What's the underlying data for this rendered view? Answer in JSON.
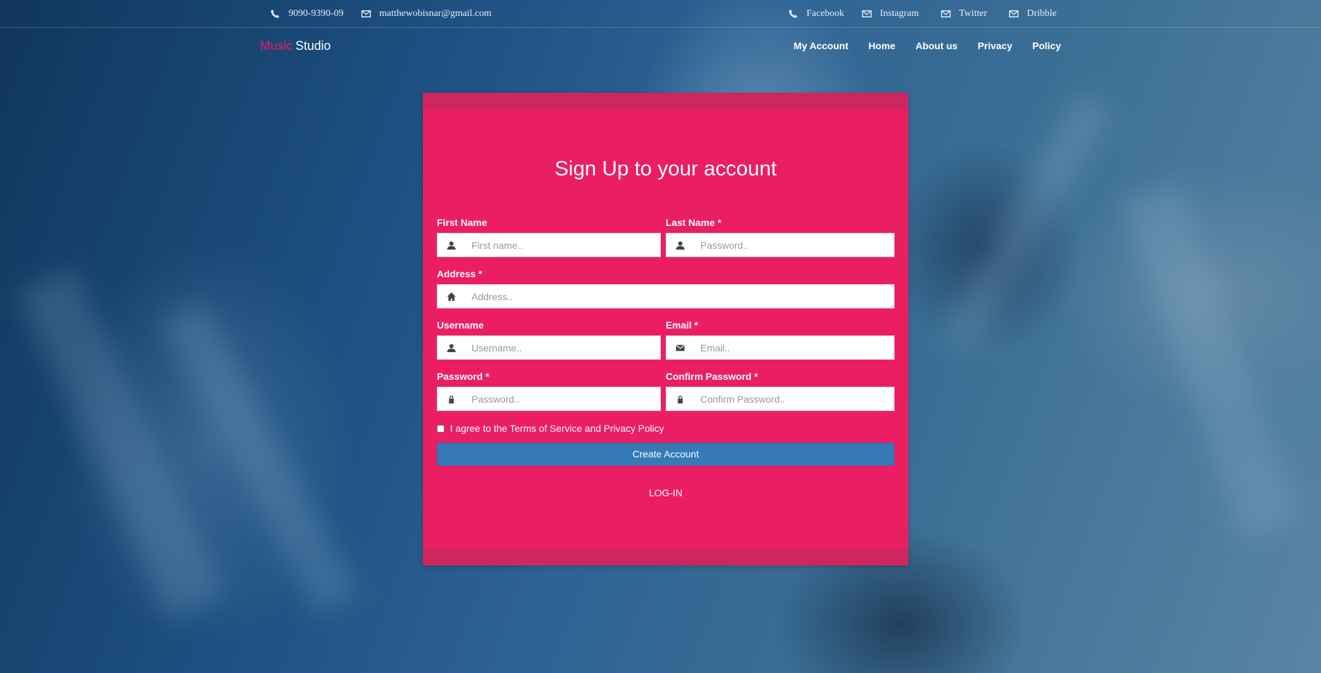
{
  "topbar": {
    "phone": "9090-9390-09",
    "email": "matthewobisnar@gmail.com",
    "social": [
      "Facebook",
      "Instagram",
      "Twitter",
      "Dribble"
    ]
  },
  "brand": {
    "part1": "Music",
    "part2": "Studio",
    "accent_color": "#ec1e63"
  },
  "nav": [
    "My Account",
    "Home",
    "About us",
    "Privacy",
    "Policy"
  ],
  "form": {
    "title": "Sign Up to your account",
    "fields": {
      "first_name": {
        "label": "First Name",
        "placeholder": "First name..",
        "icon": "user-icon"
      },
      "last_name": {
        "label": "Last Name *",
        "placeholder": "Password..",
        "icon": "user-icon"
      },
      "address": {
        "label": "Address *",
        "placeholder": "Address..",
        "icon": "home-icon"
      },
      "username": {
        "label": "Username",
        "placeholder": "Username..",
        "icon": "user-icon"
      },
      "email": {
        "label": "Email *",
        "placeholder": "Email..",
        "icon": "envelope-icon"
      },
      "password": {
        "label": "Password *",
        "placeholder": "Password..",
        "icon": "lock-icon"
      },
      "confirm_password": {
        "label": "Confirm Password *",
        "placeholder": "Confirm Password..",
        "icon": "lock-icon"
      }
    },
    "agree_text": "I agree to the Terms of Service and Privacy Policy",
    "create_button": "Create Account",
    "login_link": "LOG-IN",
    "card_color": "#ec1e63",
    "button_color": "#337ab7"
  }
}
